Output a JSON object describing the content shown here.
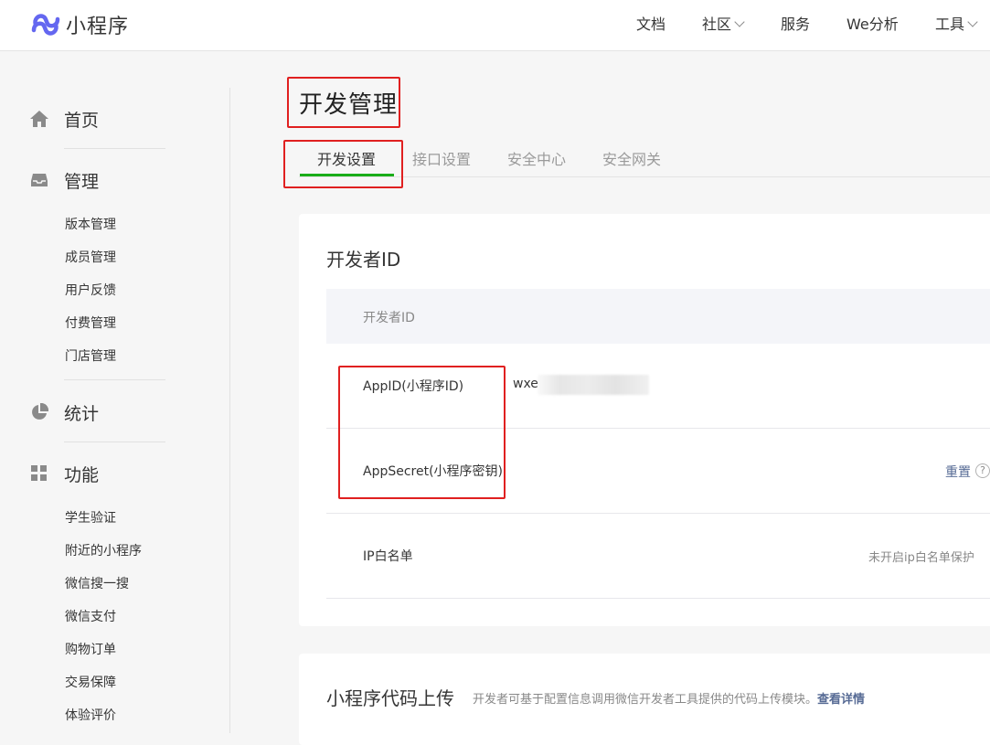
{
  "app": {
    "name": "小程序"
  },
  "topnav": [
    {
      "label": "文档",
      "has_dropdown": false
    },
    {
      "label": "社区",
      "has_dropdown": true
    },
    {
      "label": "服务",
      "has_dropdown": false
    },
    {
      "label": "We分析",
      "has_dropdown": false
    },
    {
      "label": "工具",
      "has_dropdown": true
    }
  ],
  "sidebar": {
    "home": {
      "label": "首页",
      "icon": "home-icon"
    },
    "manage": {
      "label": "管理",
      "icon": "inbox-icon",
      "items": [
        "版本管理",
        "成员管理",
        "用户反馈",
        "付费管理",
        "门店管理"
      ]
    },
    "stats": {
      "label": "统计",
      "icon": "pie-chart-icon"
    },
    "features": {
      "label": "功能",
      "icon": "grid-icon",
      "items": [
        "学生验证",
        "附近的小程序",
        "微信搜一搜",
        "微信支付",
        "购物订单",
        "交易保障",
        "体验评价"
      ]
    }
  },
  "main": {
    "title": "开发管理",
    "tabs": [
      {
        "label": "开发设置",
        "active": true
      },
      {
        "label": "接口设置",
        "active": false
      },
      {
        "label": "安全中心",
        "active": false
      },
      {
        "label": "安全网关",
        "active": false
      }
    ],
    "developer_card": {
      "title": "开发者ID",
      "table_header": "开发者ID",
      "rows": {
        "appid": {
          "label": "AppID(小程序ID)",
          "value": "wxe"
        },
        "appsecret": {
          "label": "AppSecret(小程序密钥)",
          "action": "重置",
          "help": "?"
        },
        "ip": {
          "label": "IP白名单",
          "status": "未开启ip白名单保护"
        }
      }
    },
    "upload_card": {
      "title": "小程序代码上传",
      "desc": "开发者可基于配置信息调用微信开发者工具提供的代码上传模块。",
      "link": "查看详情"
    }
  },
  "colors": {
    "accent_green": "#1aad19",
    "link_blue": "#576b95",
    "annotation_red": "#e02020",
    "logo_purple": "#6467f0"
  }
}
